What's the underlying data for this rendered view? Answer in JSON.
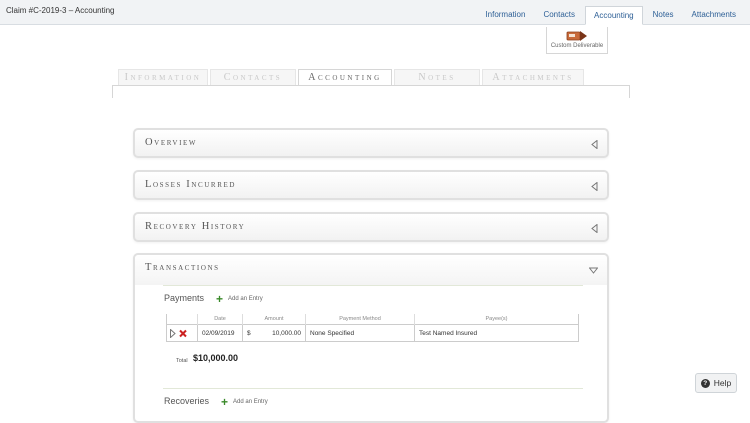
{
  "header": {
    "title": "Claim #C-2019-3 – Accounting",
    "tabs": [
      {
        "label": "Information"
      },
      {
        "label": "Contacts"
      },
      {
        "label": "Accounting"
      },
      {
        "label": "Notes"
      },
      {
        "label": "Attachments"
      }
    ],
    "active_tab": "Accounting"
  },
  "deliverable": {
    "label": "Custom Deliverable",
    "icon": "custom-deliverable-icon"
  },
  "secondary_tabs": [
    {
      "label": "Information"
    },
    {
      "label": "Contacts"
    },
    {
      "label": "Accounting"
    },
    {
      "label": "Notes"
    },
    {
      "label": "Attachments"
    }
  ],
  "panels": {
    "overview": {
      "title": "Overview",
      "state": "collapsed"
    },
    "losses": {
      "title": "Losses Incurred",
      "state": "collapsed"
    },
    "recovery": {
      "title": "Recovery History",
      "state": "collapsed"
    },
    "transactions": {
      "title": "Transactions",
      "state": "expanded",
      "payments": {
        "title": "Payments",
        "add_label": "Add an Entry",
        "columns": [
          "Date",
          "Amount",
          "Payment Method",
          "Payee(s)"
        ],
        "rows": [
          {
            "date": "02/09/2019",
            "currency": "$",
            "amount": "10,000.00",
            "method": "None Specified",
            "payee": "Test Named Insured"
          }
        ],
        "total_label": "Total",
        "total_value": "$10,000.00"
      },
      "recoveries": {
        "title": "Recoveries",
        "add_label": "Add an Entry"
      }
    }
  },
  "help": {
    "label": "Help"
  },
  "colors": {
    "link": "#2d5f96",
    "add": "#3a8a2a",
    "delete": "#cc2222"
  }
}
